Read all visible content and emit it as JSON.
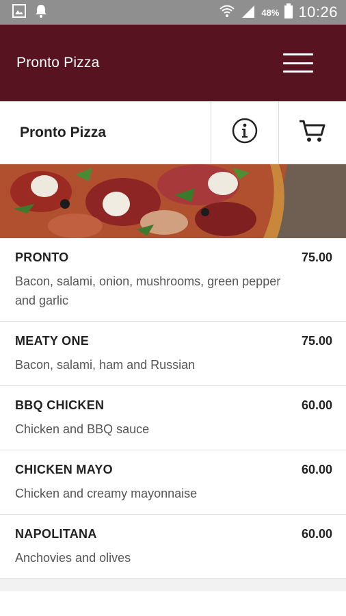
{
  "status_bar": {
    "battery_percent": "48%",
    "time": "10:26",
    "icons": [
      "gallery-icon",
      "notification-bell-icon",
      "wifi-icon",
      "signal-icon",
      "battery-icon"
    ]
  },
  "app_bar": {
    "title": "Pronto Pizza",
    "background_color": "#581321"
  },
  "sub_header": {
    "title": "Pronto Pizza",
    "info_icon": "info-icon",
    "cart_icon": "cart-icon"
  },
  "menu": {
    "items": [
      {
        "name": "PRONTO",
        "price": "75.00",
        "description": "Bacon, salami, onion, mushrooms, green pepper and garlic"
      },
      {
        "name": "MEATY ONE",
        "price": "75.00",
        "description": "Bacon, salami, ham and Russian"
      },
      {
        "name": "BBQ CHICKEN",
        "price": "60.00",
        "description": "Chicken and BBQ sauce"
      },
      {
        "name": "CHICKEN MAYO",
        "price": "60.00",
        "description": "Chicken and creamy mayonnaise"
      },
      {
        "name": "NAPOLITANA",
        "price": "60.00",
        "description": "Anchovies and olives"
      }
    ]
  }
}
